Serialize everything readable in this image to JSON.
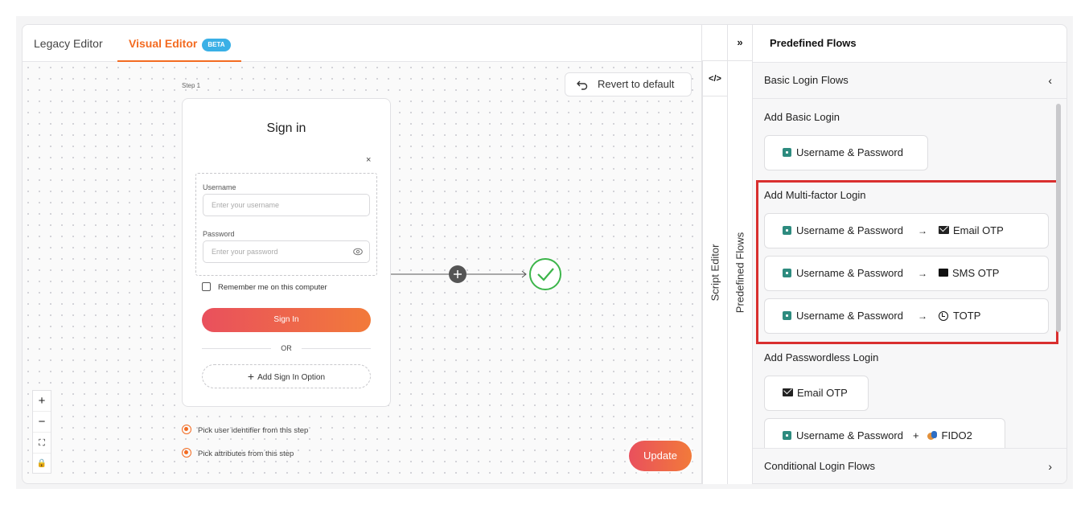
{
  "tabs": {
    "legacy": "Legacy Editor",
    "visual": "Visual Editor",
    "beta": "BETA"
  },
  "canvas": {
    "revert_label": "Revert to default",
    "step_label": "Step 1",
    "signin": {
      "title": "Sign in",
      "close": "×",
      "username_label": "Username",
      "username_placeholder": "Enter your username",
      "password_label": "Password",
      "password_placeholder": "Enter your password",
      "remember": "Remember me on this computer",
      "button": "Sign In",
      "or": "OR",
      "add_option": "Add Sign In Option"
    },
    "pick_identifier": "Pick user identifier from this step",
    "pick_attributes": "Pick attributes from this step",
    "update": "Update",
    "zoom": {
      "in": "+",
      "out": "−",
      "fit": "⛶",
      "lock": "🔒"
    }
  },
  "side": {
    "collapse_icon": "»",
    "script_toggle": "</>",
    "script_editor": "Script Editor",
    "predefined_flows": "Predefined Flows"
  },
  "panel": {
    "title": "Predefined Flows",
    "basic_group": "Basic Login Flows",
    "basic_chevron": "‹",
    "conditional_group": "Conditional Login Flows",
    "conditional_chevron": "›",
    "basic": {
      "title": "Add Basic Login",
      "flow": "Username & Password"
    },
    "mfa": {
      "title": "Add Multi-factor Login",
      "flows": [
        {
          "first": "Username & Password",
          "arrow": "→",
          "second": "Email OTP",
          "icon": "mail-icon"
        },
        {
          "first": "Username & Password",
          "arrow": "→",
          "second": "SMS OTP",
          "icon": "sms-icon"
        },
        {
          "first": "Username & Password",
          "arrow": "→",
          "second": "TOTP",
          "icon": "clock-icon"
        }
      ]
    },
    "passwordless": {
      "title": "Add Passwordless Login",
      "email_otp": "Email OTP",
      "combo_first": "Username & Password",
      "combo_plus": "+",
      "combo_second": "FIDO2"
    }
  },
  "colors": {
    "accent": "#f36b21",
    "highlight": "#d92f2f",
    "success": "#3cb54a",
    "lock": "#2d8b7f"
  }
}
